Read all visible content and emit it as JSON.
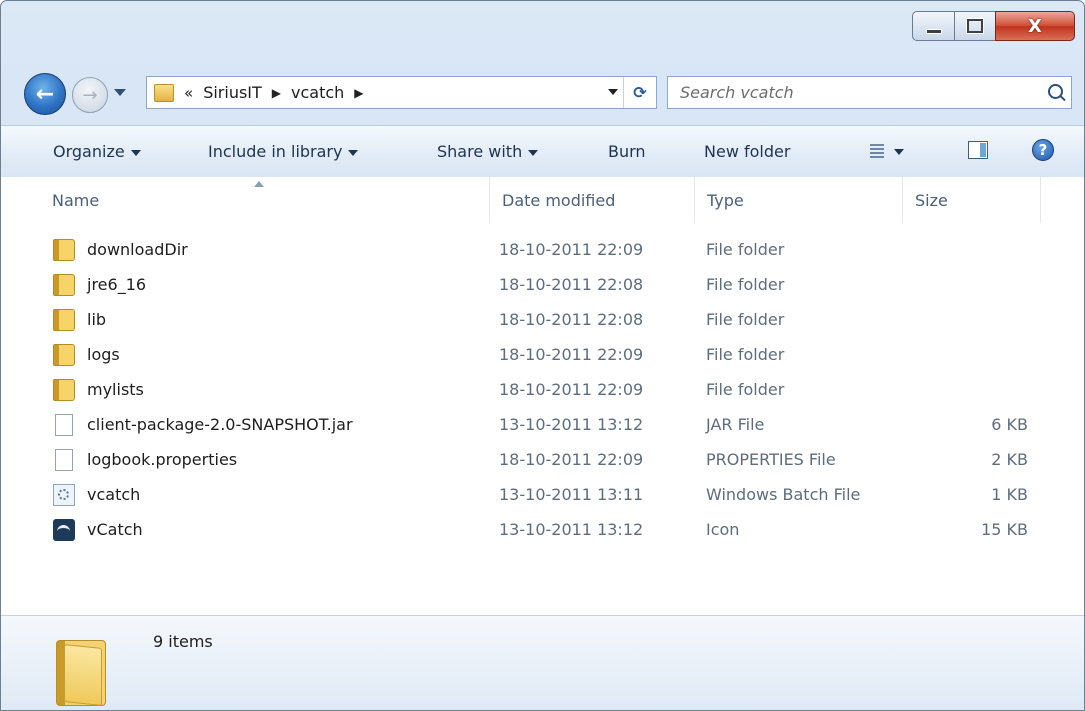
{
  "window": {
    "minimize_glyph": "",
    "close_glyph": "X"
  },
  "nav": {
    "back_glyph": "←",
    "forward_glyph": "→",
    "breadcrumb": {
      "overflow": "«",
      "items": [
        "SiriusIT",
        "vcatch"
      ],
      "separator": "▶"
    },
    "refresh_glyph": "⟳"
  },
  "search": {
    "placeholder": "Search vcatch"
  },
  "toolbar": {
    "organize": "Organize",
    "include_in_library": "Include in library",
    "share_with": "Share with",
    "burn": "Burn",
    "new_folder": "New folder",
    "help_glyph": "?"
  },
  "columns": {
    "name": "Name",
    "date": "Date modified",
    "type": "Type",
    "size": "Size"
  },
  "files": [
    {
      "icon": "folder-icon",
      "name": "downloadDir",
      "date": "18-10-2011 22:09",
      "type": "File folder",
      "size": ""
    },
    {
      "icon": "folder-icon",
      "name": "jre6_16",
      "date": "18-10-2011 22:08",
      "type": "File folder",
      "size": ""
    },
    {
      "icon": "folder-icon",
      "name": "lib",
      "date": "18-10-2011 22:08",
      "type": "File folder",
      "size": ""
    },
    {
      "icon": "folder-icon",
      "name": "logs",
      "date": "18-10-2011 22:09",
      "type": "File folder",
      "size": ""
    },
    {
      "icon": "folder-icon",
      "name": "mylists",
      "date": "18-10-2011 22:09",
      "type": "File folder",
      "size": ""
    },
    {
      "icon": "file-icon",
      "name": "client-package-2.0-SNAPSHOT.jar",
      "date": "13-10-2011 13:12",
      "type": "JAR File",
      "size": "6 KB"
    },
    {
      "icon": "file-icon",
      "name": "logbook.properties",
      "date": "18-10-2011 22:09",
      "type": "PROPERTIES File",
      "size": "2 KB"
    },
    {
      "icon": "batch-file-icon",
      "name": "vcatch",
      "date": "13-10-2011 13:11",
      "type": "Windows Batch File",
      "size": "1 KB"
    },
    {
      "icon": "vcatch-app-icon",
      "name": "vCatch",
      "date": "13-10-2011 13:12",
      "type": "Icon",
      "size": "15 KB"
    }
  ],
  "details": {
    "item_count": "9 items"
  }
}
